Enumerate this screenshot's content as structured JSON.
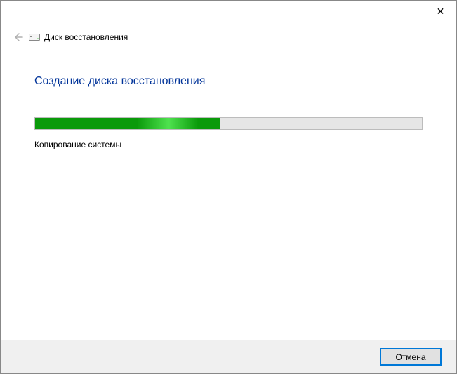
{
  "window": {
    "header_title": "Диск восстановления",
    "close_glyph": "✕"
  },
  "page": {
    "title": "Создание диска восстановления",
    "status": "Копирование системы",
    "progress_percent": 48
  },
  "buttons": {
    "cancel": "Отмена"
  }
}
